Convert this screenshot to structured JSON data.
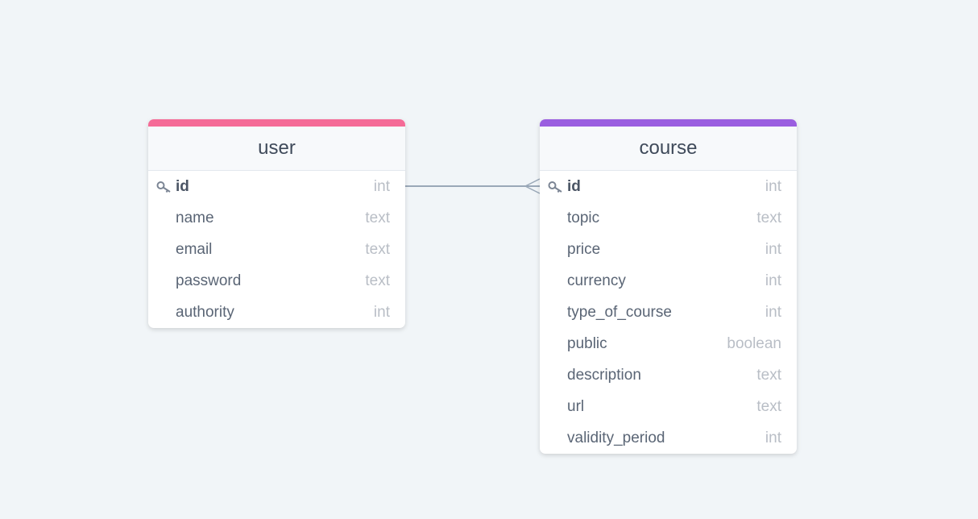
{
  "tables": [
    {
      "name": "user",
      "color": "#f56b97",
      "columns": [
        {
          "name": "id",
          "type": "int",
          "primary_key": true
        },
        {
          "name": "name",
          "type": "text"
        },
        {
          "name": "email",
          "type": "text"
        },
        {
          "name": "password",
          "type": "text"
        },
        {
          "name": "authority",
          "type": "int"
        }
      ]
    },
    {
      "name": "course",
      "color": "#9a5ee0",
      "columns": [
        {
          "name": "id",
          "type": "int",
          "primary_key": true
        },
        {
          "name": "topic",
          "type": "text"
        },
        {
          "name": "price",
          "type": "int"
        },
        {
          "name": "currency",
          "type": "int"
        },
        {
          "name": "type_of_course",
          "type": "int"
        },
        {
          "name": "public",
          "type": "boolean"
        },
        {
          "name": "description",
          "type": "text"
        },
        {
          "name": "url",
          "type": "text"
        },
        {
          "name": "validity_period",
          "type": "int"
        }
      ]
    }
  ],
  "relationships": [
    {
      "from": "user.id",
      "to": "course.id",
      "type": "one-to-many",
      "color": "#9aa8b8"
    }
  ]
}
